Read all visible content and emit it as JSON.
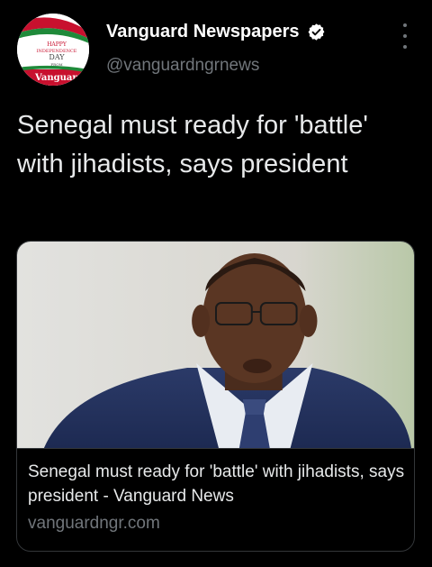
{
  "author": {
    "name": "Vanguard Newspapers",
    "handle": "@vanguardngrnews",
    "avatar_text_lines": [
      "HAPPY",
      "INDEPENDENCE",
      "DAY",
      "FROM",
      "Vanguard"
    ]
  },
  "tweet": {
    "text": "Senegal must ready for 'battle' with jihadists, says president"
  },
  "card": {
    "title": "Senegal must ready for 'battle' with jihadists, says president - Vanguard News",
    "domain": "vanguardngr.com",
    "image_icon": "news-photo"
  },
  "icons": {
    "verified": "verified-badge-icon",
    "more": "more-options-icon"
  },
  "colors": {
    "background": "#000000",
    "text_primary": "#e7e9ea",
    "text_secondary": "#71767b",
    "border": "#333639",
    "avatar_red": "#c8102e",
    "avatar_green": "#1f8a3a"
  }
}
